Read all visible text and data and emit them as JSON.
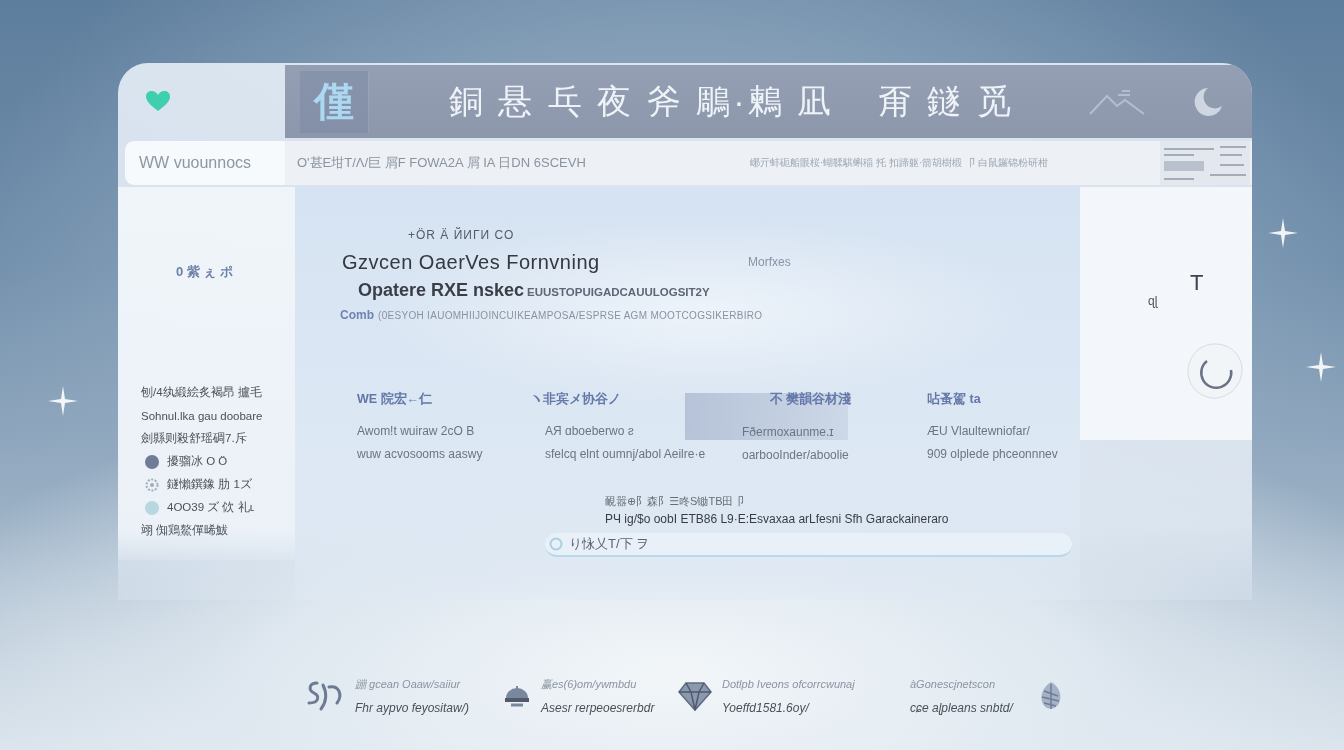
{
  "window": {
    "logo": "僅",
    "title": "銅 悬 乓 夜 斧 鵰·鶫 凪",
    "title_suffix": "甭 鐩 觅"
  },
  "search": {
    "placeholder": "WW vuounnocs"
  },
  "info_bar": {
    "path": "O'甚E坩T/Ʌ/巨 屑F FOWA2A 屑 IA 日DN 6SCEVH",
    "status": "峫亓蚌砈船眼桜·蝴鞣騏蝌稲 托 扣蹄躯·箭胡樹椴 卩 白鼠鑼锦粉研柑"
  },
  "sidebar": {
    "heading": "0 紫 ぇ ポ",
    "items": [
      {
        "kind": "text",
        "label": "刨/4纨緞絵炙褐昂 攎毛"
      },
      {
        "kind": "text",
        "label": "Sohnul.lka gau doobare"
      },
      {
        "kind": "text",
        "label": "劍縣则殺舒瑶碉7.斥"
      },
      {
        "kind": "dot",
        "label": "擾骝冰 O Ö",
        "color": "#6e7c97"
      },
      {
        "kind": "ring",
        "label": "鐩懶鐉鐌 肋 1ズ",
        "color": "#a3adba"
      },
      {
        "kind": "dot",
        "label": "4OO39 ズ 佽 礼ʟ",
        "color": "#b9d7df"
      },
      {
        "kind": "text",
        "label": "翊 倁鶏鰲僤晞鮁"
      }
    ]
  },
  "hero": {
    "eyebrow": "+ÖR Ä ЙИГИ CO",
    "title": "Gzvcen OaerVes Fornvning",
    "aside": "Morfxes",
    "subtitle": "Opatere RXE nskec",
    "subtitle_tail": "EUUSTOPUIGADCAUULOGSIT2Y",
    "caption_label": "Comb",
    "caption": "(0ESYOH IAUOMHIIJOINCUIKEAMPOSA/ESPRSE AGM MOOTCOGSIKERBIRO"
  },
  "cards": [
    {
      "kind": "plain",
      "title": "WE 院宏←仁",
      "lines": [
        "Awom!t wuiraw 2cO B",
        "wuw acvosooms aaswy"
      ]
    },
    {
      "kind": "plain",
      "title": "ヽ非宾メ协谷ノ",
      "lines": [
        "AЯ ɑboeberwo ƨ",
        "sfelcq elnt oumnj/abol Aeilre·e"
      ]
    },
    {
      "kind": "shaded",
      "title": "不 樊韻谷材淺",
      "lines": [
        "Fðermoxaunme.ɪ",
        "oarbooInder/aboolie"
      ]
    },
    {
      "kind": "plain",
      "title": "呫蚤駕 ta",
      "lines": [
        "ÆU Vlaultewniofar/",
        "909 olplede phceonnnev"
      ]
    }
  ],
  "notice": {
    "heading": "靦嚣⊕阝森阝☰咚S锄TB田卩",
    "text": "PЧ ig/$o oobI ETB86 L9·E:Esvaxaa arLfesni Sfh Garackaineraro"
  },
  "input": {
    "value": "り怺乂T/下 ヲ"
  },
  "side_panel": {
    "letter": "T",
    "caption": "ɋɭ"
  },
  "footer": {
    "items": [
      {
        "kind": "squiggle",
        "lines": [
          "蹦 gcean Oaaw/saiiur",
          "Fhr aypvo feyositaw/)"
        ]
      },
      {
        "kind": "bowl",
        "lines": [
          "赢es(6)om/ywmbdu",
          "Asesr rerpeoesrerbdr"
        ]
      },
      {
        "kind": "gem",
        "lines": [
          "Dotlpb Iveons ofcorrcwunaj",
          "Yoeffd1581.6oy/"
        ]
      },
      {
        "kind": "leaf",
        "lines": [
          "àGonescjnetscon",
          "cɕe aɭpleans snbtd/"
        ]
      }
    ]
  }
}
